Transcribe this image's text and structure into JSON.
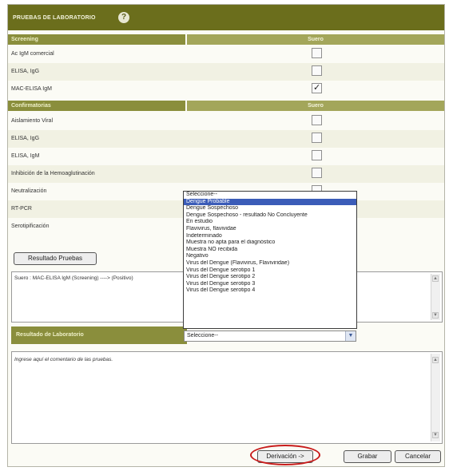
{
  "title": "PRUEBAS DE LABORATORIO",
  "help_icon": "?",
  "screening": {
    "header_left": "Screening",
    "header_right": "Suero",
    "rows": [
      {
        "label": "Ac IgM comercial",
        "checked": false
      },
      {
        "label": "ELISA, IgG",
        "checked": false
      },
      {
        "label": "MAC-ELISA IgM",
        "checked": true
      }
    ]
  },
  "confirmatorias": {
    "header_left": "Confirmatorias",
    "header_right": "Suero",
    "rows": [
      {
        "label": "Aislamiento Viral",
        "checked": false
      },
      {
        "label": "ELISA, IgG",
        "checked": false
      },
      {
        "label": "ELISA, IgM",
        "checked": false
      },
      {
        "label": "Inhibición de la Hemoaglutinación",
        "checked": false
      },
      {
        "label": "Neutralización",
        "checked": false
      },
      {
        "label": "RT-PCR",
        "checked": false
      },
      {
        "label": "Serotipificación",
        "checked": false
      }
    ]
  },
  "resultado_button": "Resultado Pruebas",
  "result_text": "Suero : MAC-ELISA IgM (Screening) ----> (Positivo)",
  "dropdown": {
    "options": [
      "Seleccione--",
      "Dengue Probable",
      "Dengue Sospechoso",
      "Dengue Sospechoso - resultado No Concluyente",
      "En estudio",
      "Flavivirus, flavividae",
      "Indeterminado",
      "Muestra no apta para el diagnóstico",
      "Muestra NO recibida",
      "Negativo",
      "Virus del Dengue (Flavivirus, Flaviviridae)",
      "Virus del Dengue serotipo 1",
      "Virus del Dengue serotipo 2",
      "Virus del Dengue serotipo 3",
      "Virus del Dengue serotipo 4"
    ],
    "highlighted_index": 1
  },
  "lab_result": {
    "label": "Resultado de Laboratorio",
    "selected": "Seleccione--"
  },
  "comment_placeholder": "Ingrese aquí el comentario de las pruebas.",
  "footer": {
    "derivacion": "Derivación ->",
    "grabar": "Grabar",
    "cancelar": "Cancelar"
  },
  "colors": {
    "header_dark": "#6b6e1c",
    "header_mid": "#8a8e3c",
    "highlight": "#3b5cb8",
    "annotation": "#c81b1b"
  }
}
